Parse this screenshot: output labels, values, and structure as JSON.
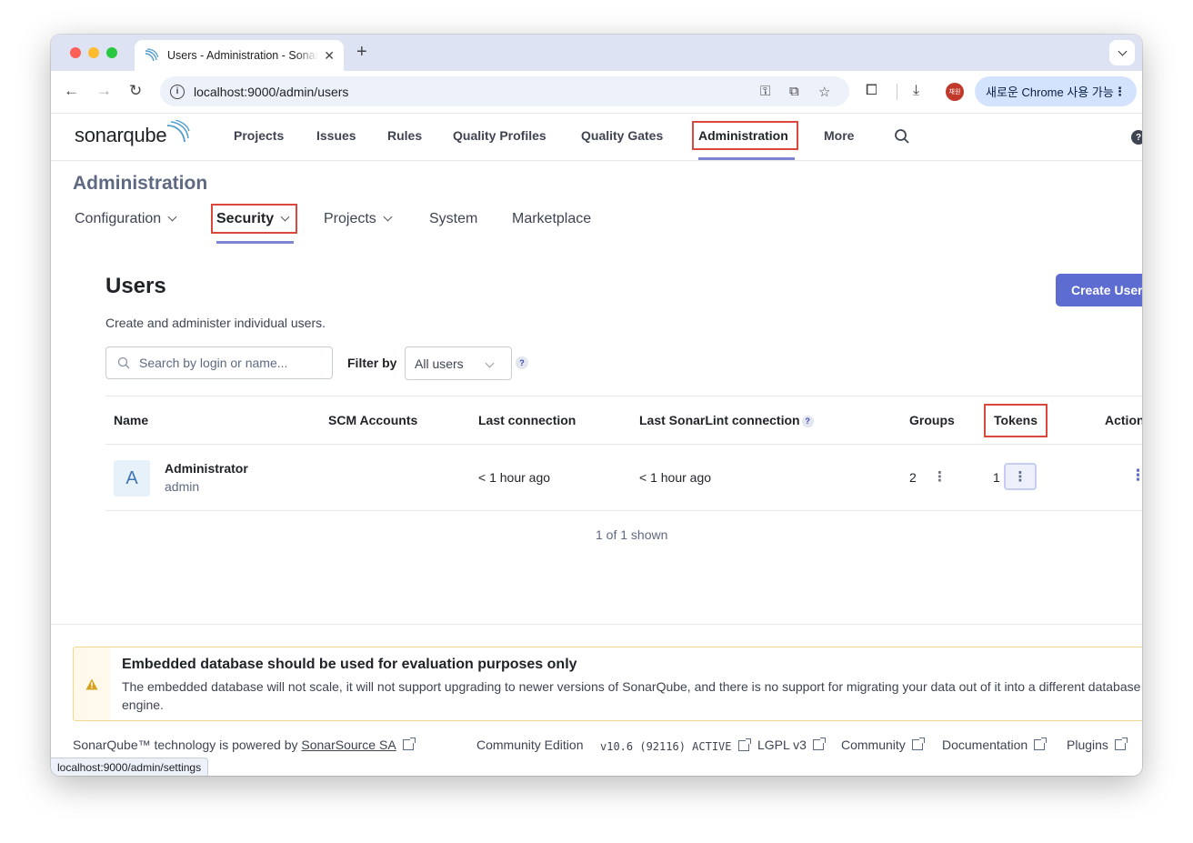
{
  "browser": {
    "tab_title": "Users - Administration - SonarQube",
    "tab_close": "✕",
    "new_tab": "+",
    "url": "localhost:9000/admin/users",
    "profile_initials": "채원",
    "chrome_update_label": "새로운 Chrome 사용 가능",
    "status_url": "localhost:9000/admin/settings"
  },
  "logo": {
    "part1": "sonar",
    "part2": "qube"
  },
  "nav": {
    "items": [
      "Projects",
      "Issues",
      "Rules",
      "Quality Profiles",
      "Quality Gates",
      "Administration",
      "More"
    ],
    "active": "Administration",
    "help": "?"
  },
  "admin": {
    "title": "Administration",
    "tabs": [
      {
        "label": "Configuration",
        "dropdown": true
      },
      {
        "label": "Security",
        "dropdown": true,
        "active": true
      },
      {
        "label": "Projects",
        "dropdown": true
      },
      {
        "label": "System",
        "dropdown": false
      },
      {
        "label": "Marketplace",
        "dropdown": false
      }
    ]
  },
  "users_page": {
    "title": "Users",
    "description": "Create and administer individual users.",
    "create_button": "Create User",
    "search_placeholder": "Search by login or name...",
    "filter_label": "Filter by",
    "filter_value": "All users",
    "filter_help": "?",
    "columns": [
      "Name",
      "SCM Accounts",
      "Last connection",
      "Last SonarLint connection",
      "Groups",
      "Tokens",
      "Actions"
    ],
    "column_help": "?",
    "rows": [
      {
        "avatar_letter": "A",
        "name": "Administrator",
        "login": "admin",
        "scm_accounts": "",
        "last_connection": "< 1 hour ago",
        "last_sonarlint": "< 1 hour ago",
        "groups": "2",
        "tokens": "1"
      }
    ],
    "shown_text": "1 of 1 shown"
  },
  "warning": {
    "title": "Embedded database should be used for evaluation purposes only",
    "text": "The embedded database will not scale, it will not support upgrading to newer versions of SonarQube, and there is no support for migrating your data out of it into a different database engine."
  },
  "footer": {
    "powered_prefix": "SonarQube™ technology is powered by",
    "powered_link": "SonarSource SA",
    "edition": "Community Edition",
    "version": "v10.6 (92116) ACTIVE",
    "license": "LGPL v3",
    "community": "Community",
    "documentation": "Documentation",
    "plugins": "Plugins"
  },
  "colors": {
    "accent": "#5d6cd0",
    "highlight_box": "#d9483b",
    "underline": "#7e83d3",
    "warning_bg": "#fef9ea",
    "warning_icon": "#d6a11e"
  }
}
